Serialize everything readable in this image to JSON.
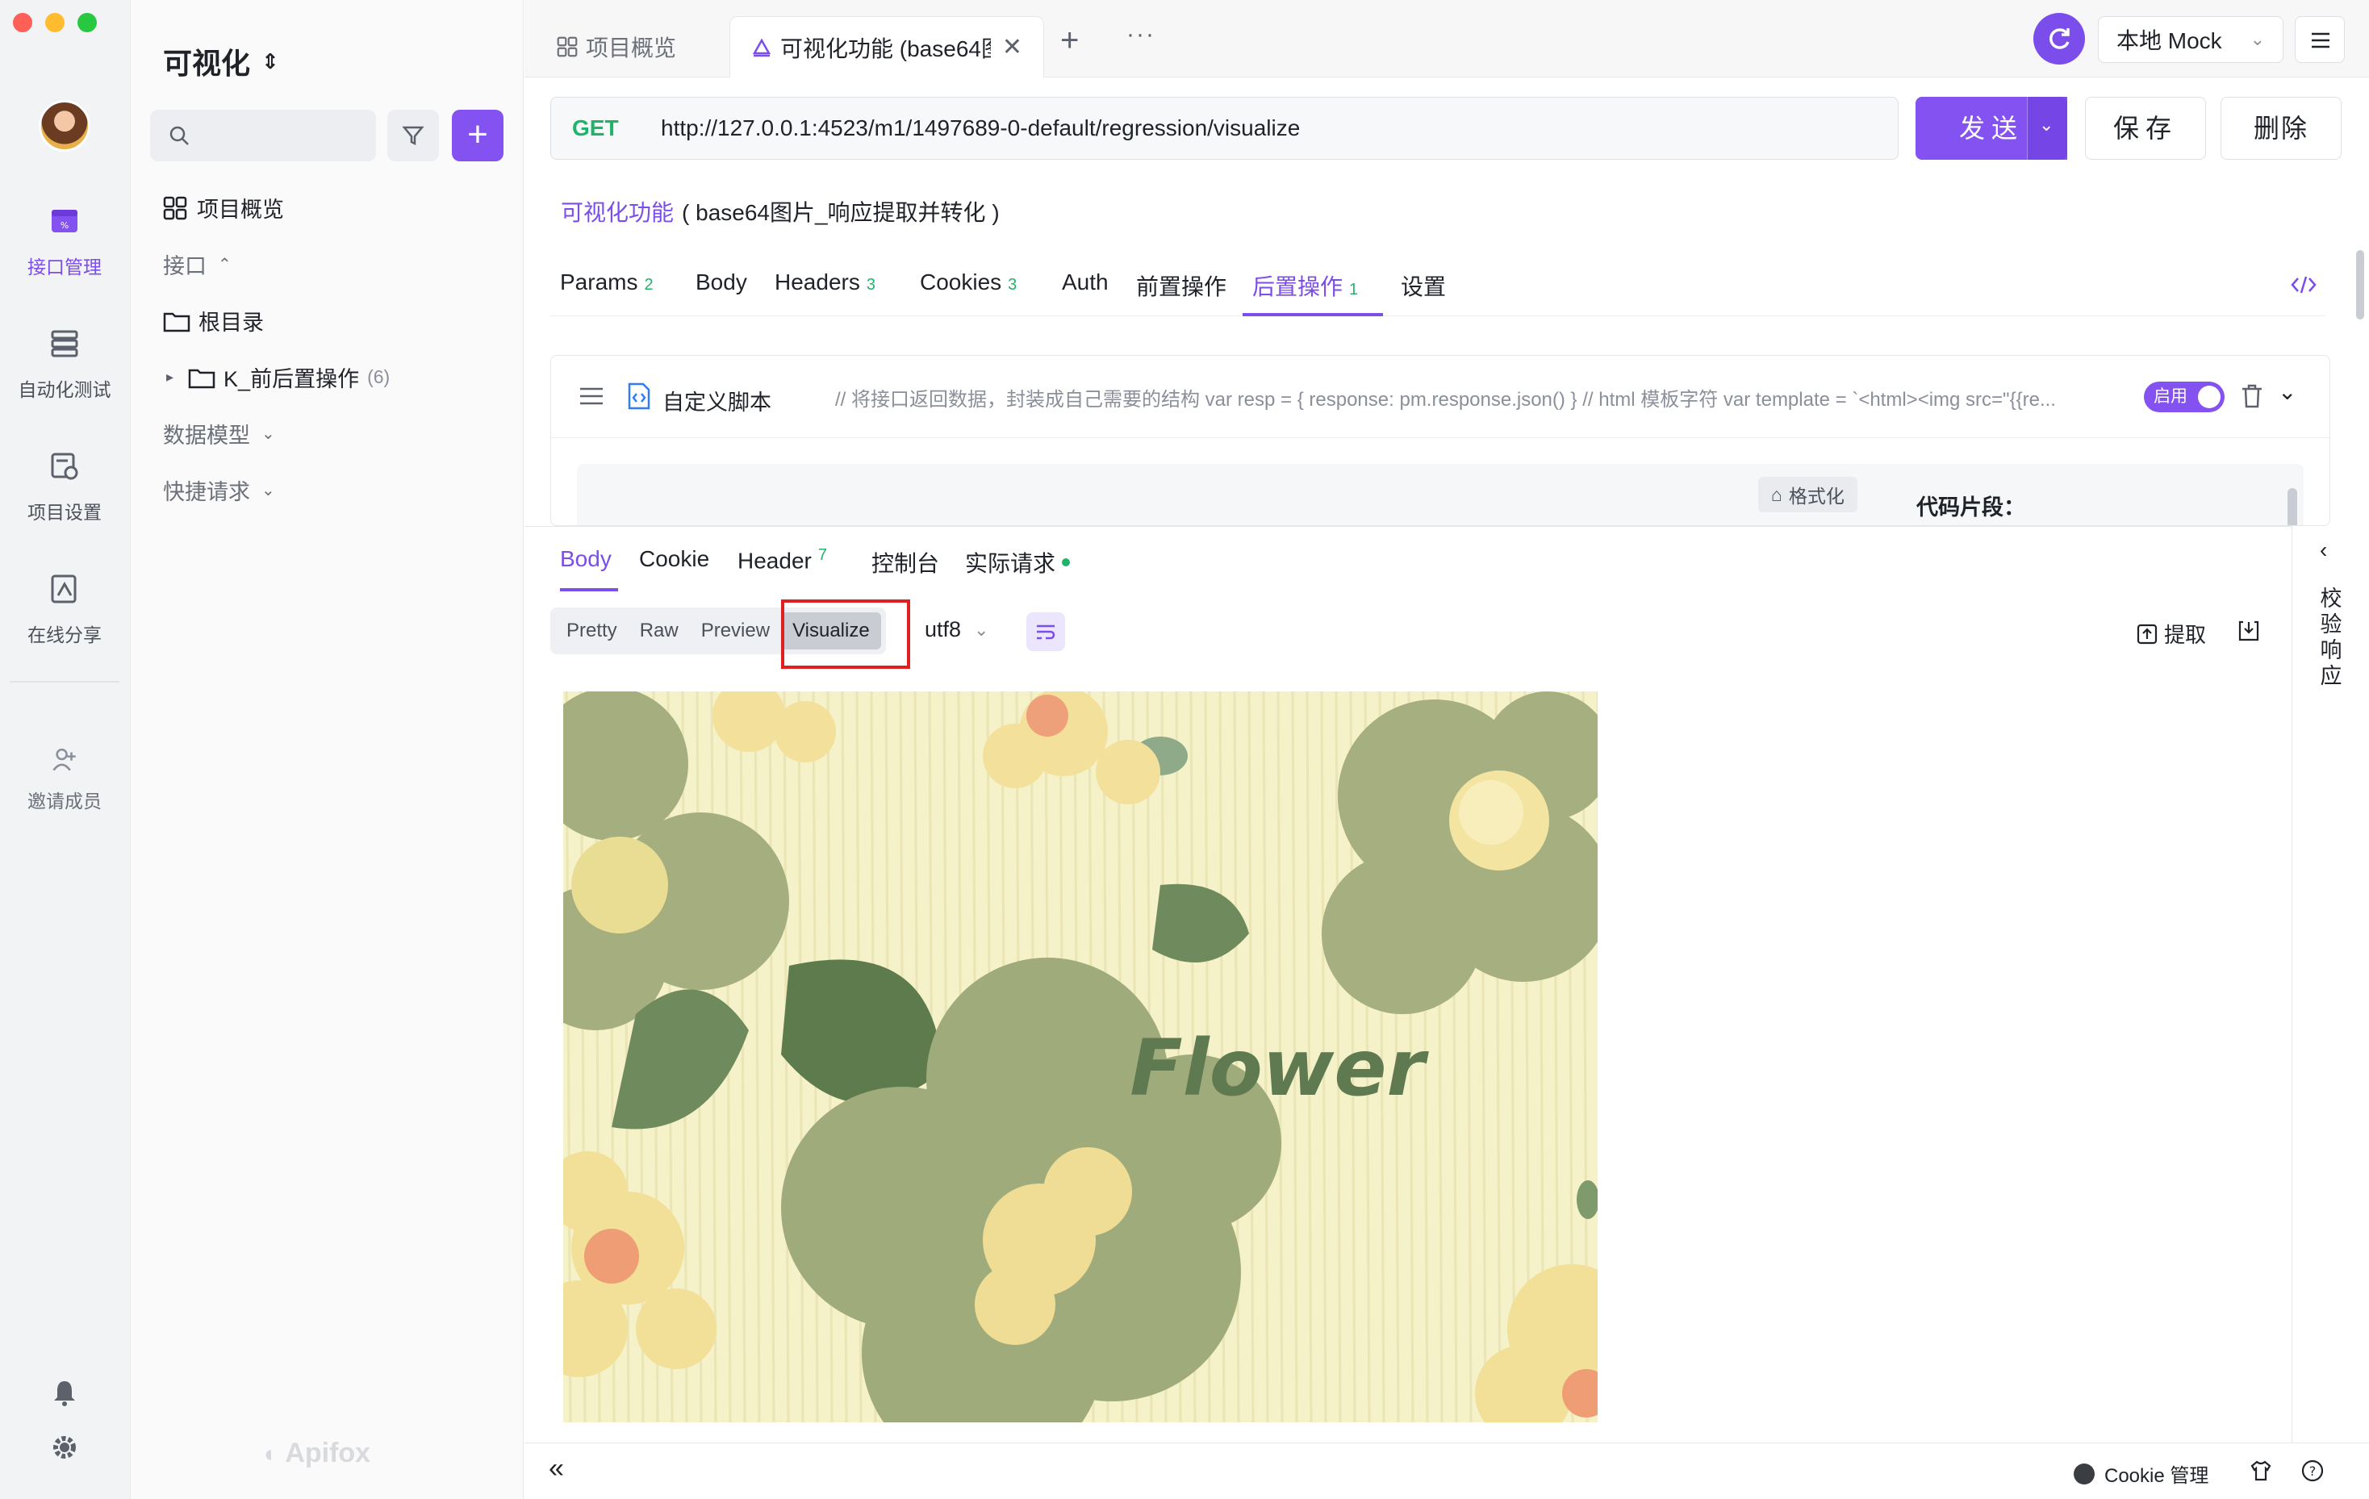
{
  "rail": {
    "items": [
      {
        "label": "接口管理",
        "icon": "api-management-icon"
      },
      {
        "label": "自动化测试",
        "icon": "automation-test-icon"
      },
      {
        "label": "项目设置",
        "icon": "project-settings-icon"
      },
      {
        "label": "在线分享",
        "icon": "online-share-icon"
      },
      {
        "label": "邀请成员",
        "icon": "invite-member-icon"
      }
    ]
  },
  "sidebar": {
    "project_title": "可视化",
    "overview": "项目概览",
    "section_api": "接口",
    "root": "根目录",
    "folder_name": "K_前后置操作",
    "folder_count": "(6)",
    "section_models": "数据模型",
    "section_quick": "快捷请求",
    "brand": "Apifox"
  },
  "tabs": {
    "overview": "项目概览",
    "active": "可视化功能 (base64图"
  },
  "env": {
    "label": "本地 Mock"
  },
  "request": {
    "method": "GET",
    "url": "http://127.0.0.1:4523/m1/1497689-0-default/regression/visualize",
    "send": "发送",
    "save": "保存",
    "delete": "删除",
    "api_name": "可视化功能",
    "api_desc": "( base64图片_响应提取并转化 )"
  },
  "req_tabs": [
    {
      "label": "Params",
      "count": "2"
    },
    {
      "label": "Body",
      "count": ""
    },
    {
      "label": "Headers",
      "count": "3"
    },
    {
      "label": "Cookies",
      "count": "3"
    },
    {
      "label": "Auth",
      "count": ""
    },
    {
      "label": "前置操作",
      "count": ""
    },
    {
      "label": "后置操作",
      "count": "1"
    },
    {
      "label": "设置",
      "count": ""
    }
  ],
  "script": {
    "title": "自定义脚本",
    "preview": "// 将接口返回数据，封装成自己需要的结构 var resp = { response: pm.response.json() } // html 模板字符 var template = `<html><img src=\"{{re...",
    "toggle": "启用",
    "format_btn": "格式化",
    "snippet_label": "代码片段："
  },
  "resp_tabs": [
    {
      "label": "Body",
      "count": ""
    },
    {
      "label": "Cookie",
      "count": ""
    },
    {
      "label": "Header",
      "count": "7"
    },
    {
      "label": "控制台",
      "count": ""
    },
    {
      "label": "实际请求",
      "count": ""
    }
  ],
  "view_modes": [
    "Pretty",
    "Raw",
    "Preview",
    "Visualize"
  ],
  "encoding": "utf8",
  "extract": "提取",
  "verify": "校验响应",
  "image_text": "Flower",
  "status": {
    "cookie": "Cookie 管理"
  },
  "colors": {
    "accent": "#7b4dea",
    "method_get": "#22b36b",
    "highlight": "#e02020"
  }
}
